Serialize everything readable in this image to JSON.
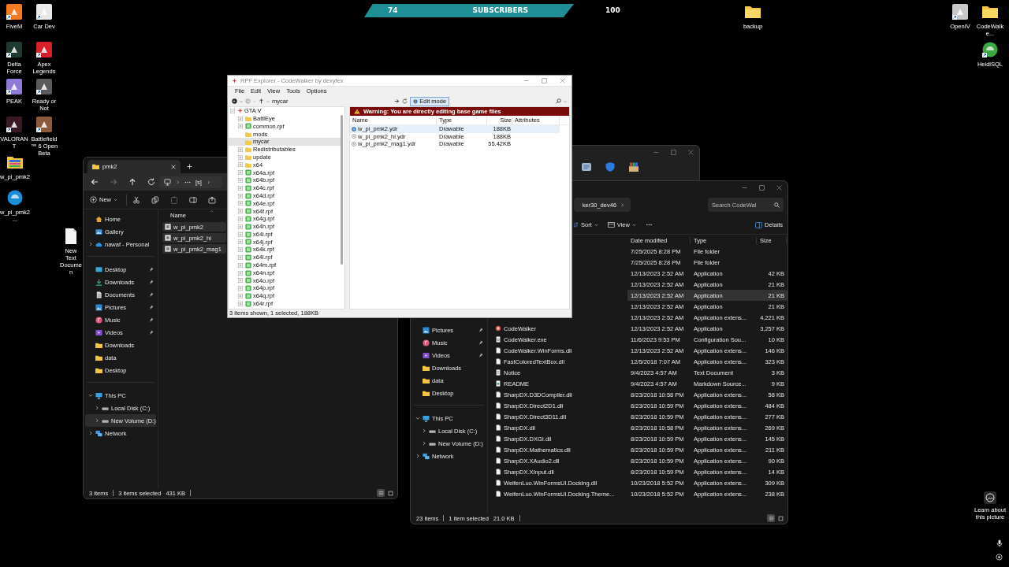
{
  "subscriber_goal": {
    "count": "74",
    "label": "SUBSCRIBERS",
    "goal": "100"
  },
  "desktop_icons": [
    {
      "label": "FiveM",
      "kind": "tile",
      "color": "#f47b20",
      "shortcut": true
    },
    {
      "label": "Car Dev",
      "kind": "tile",
      "color": "#e8e8e8",
      "shortcut": true
    },
    {
      "label": "Delta Force",
      "kind": "tile",
      "color": "#1f3b2f",
      "shortcut": true
    },
    {
      "label": "Apex Legends",
      "kind": "tile",
      "color": "#d5202a",
      "shortcut": true
    },
    {
      "label": "PEAK",
      "kind": "tile",
      "color": "#8f7ad8",
      "shortcut": true
    },
    {
      "label": "Ready or Not",
      "kind": "tile",
      "color": "#5a5a5a",
      "shortcut": true
    },
    {
      "label": "VALORANT",
      "kind": "tile",
      "color": "#3a1a24",
      "shortcut": true
    },
    {
      "label": "Battlefield™ 6 Open Beta",
      "kind": "tile",
      "color": "#8a5a3a",
      "shortcut": true
    },
    {
      "label": "w_pi_pmk2",
      "kind": "archive",
      "shortcut": false
    },
    {
      "label": "w_pi_pmk2...",
      "kind": "round",
      "color": "#1a8fd8",
      "shortcut": false
    },
    {
      "label": "New Text Documen",
      "kind": "document",
      "shortcut": false
    },
    {
      "label": "backup",
      "kind": "folder",
      "shortcut": false
    },
    {
      "label": "OpenIV",
      "kind": "tile",
      "color": "#c8c8c8",
      "shortcut": true
    },
    {
      "label": "CodeWalke...",
      "kind": "folder",
      "shortcut": false
    },
    {
      "label": "HeidiSQL",
      "kind": "round",
      "color": "#3aa845",
      "shortcut": true
    }
  ],
  "explorer_left": {
    "tab": {
      "title": "pmk2"
    },
    "breadcrumb": [
      "[s]"
    ],
    "new_label": "New",
    "sidebar": [
      {
        "items": [
          {
            "label": "Home",
            "kind": "home",
            "pinned": false,
            "selected": false
          },
          {
            "label": "Gallery",
            "kind": "gallery",
            "pinned": false,
            "selected": false
          },
          {
            "label": "nawaf - Personal",
            "kind": "cloud",
            "expanded": false,
            "pinned": false,
            "selected": false
          }
        ]
      },
      {
        "items": [
          {
            "label": "Desktop",
            "kind": "desktop",
            "pinned": true,
            "selected": false
          },
          {
            "label": "Downloads",
            "kind": "download",
            "pinned": true,
            "selected": false
          },
          {
            "label": "Documents",
            "kind": "document",
            "pinned": true,
            "selected": false
          },
          {
            "label": "Pictures",
            "kind": "pictures",
            "pinned": true,
            "selected": false
          },
          {
            "label": "Music",
            "kind": "music",
            "pinned": true,
            "selected": false
          },
          {
            "label": "Videos",
            "kind": "video",
            "pinned": true,
            "selected": false
          },
          {
            "label": "Downloads",
            "kind": "folder",
            "pinned": false,
            "selected": false
          },
          {
            "label": "data",
            "kind": "folder",
            "pinned": false,
            "selected": false
          },
          {
            "label": "Desktop",
            "kind": "folder",
            "pinned": false,
            "selected": false
          }
        ]
      },
      {
        "items": [
          {
            "label": "This PC",
            "kind": "pc",
            "expanded": true,
            "pinned": false,
            "selected": false,
            "children": [
              {
                "label": "Local Disk (C:)",
                "kind": "drive",
                "expanded": false,
                "pinned": false,
                "selected": false
              },
              {
                "label": "New Volume (D:)",
                "kind": "drive",
                "expanded": false,
                "pinned": false,
                "selected": true
              }
            ]
          },
          {
            "label": "Network",
            "kind": "network",
            "expanded": false,
            "pinned": false,
            "selected": false
          }
        ]
      }
    ],
    "columns": [
      "Name"
    ],
    "files": [
      {
        "name": "w_pi_pmk2",
        "selected": true
      },
      {
        "name": "w_pi_pmk2_hi",
        "selected": true
      },
      {
        "name": "w_pi_pmk2_mag1",
        "selected": true
      }
    ],
    "status": [
      "3 items",
      "3 items selected",
      "431 KB"
    ],
    "view_modes": [
      {
        "kind": "details",
        "selected": true
      },
      {
        "kind": "tiles",
        "selected": false
      }
    ]
  },
  "background_window": {
    "apps": [
      {
        "kind": "notes"
      },
      {
        "kind": "shield"
      },
      {
        "kind": "package"
      }
    ]
  },
  "explorer_right": {
    "address": "ker30_dev46",
    "search": {
      "placeholder": "Search CodeWal"
    },
    "sort_label": "Sort",
    "view_label": "View",
    "details_label": "Details",
    "sidebar": [
      {
        "items": [
          {
            "label": "Pictures",
            "kind": "pictures",
            "pinned": true,
            "selected": false
          },
          {
            "label": "Music",
            "kind": "music",
            "pinned": true,
            "selected": false
          },
          {
            "label": "Videos",
            "kind": "video",
            "pinned": true,
            "selected": false
          },
          {
            "label": "Downloads",
            "kind": "folder",
            "pinned": false,
            "selected": false
          },
          {
            "label": "data",
            "kind": "folder",
            "pinned": false,
            "selected": false
          },
          {
            "label": "Desktop",
            "kind": "folder",
            "pinned": false,
            "selected": false
          }
        ]
      },
      {
        "items": [
          {
            "label": "This PC",
            "kind": "pc",
            "expanded": true,
            "pinned": false,
            "selected": false,
            "children": [
              {
                "label": "Local Disk (C:)",
                "kind": "drive",
                "expanded": false,
                "pinned": false,
                "selected": false
              },
              {
                "label": "New Volume (D:)",
                "kind": "drive",
                "expanded": false,
                "pinned": false,
                "selected": false
              }
            ]
          },
          {
            "label": "Network",
            "kind": "network",
            "expanded": false,
            "pinned": false,
            "selected": false
          }
        ]
      }
    ],
    "columns": [
      "Date modified",
      "Type",
      "Size"
    ],
    "files": [
      {
        "date": "7/25/2025 8:28 PM",
        "type": "File folder",
        "selected": false
      },
      {
        "date": "7/25/2025 8:28 PM",
        "type": "File folder",
        "selected": false
      },
      {
        "date": "12/13/2023 2:52 AM",
        "type": "Application",
        "size": "42 KB",
        "selected": false
      },
      {
        "date": "12/13/2023 2:52 AM",
        "type": "Application",
        "size": "21 KB",
        "selected": false
      },
      {
        "date": "12/13/2023 2:52 AM",
        "type": "Application",
        "size": "21 KB",
        "selected": true
      },
      {
        "date": "12/13/2023 2:52 AM",
        "type": "Application",
        "size": "21 KB",
        "selected": false
      },
      {
        "date": "12/13/2023 2:52 AM",
        "type": "Application extens...",
        "size": "4,221 KB",
        "selected": false
      },
      {
        "name": "CodeWalker",
        "kind": "app",
        "date": "12/13/2023 2:52 AM",
        "type": "Application",
        "size": "3,257 KB",
        "selected": false
      },
      {
        "name": "CodeWalker.exe",
        "kind": "config",
        "date": "11/6/2023 9:53 PM",
        "type": "Configuration Sou...",
        "size": "10 KB",
        "selected": false
      },
      {
        "name": "CodeWalker.WinForms.dll",
        "kind": "file",
        "date": "12/13/2023 2:52 AM",
        "type": "Application extens...",
        "size": "146 KB",
        "selected": false
      },
      {
        "name": "FastColoredTextBox.dll",
        "kind": "file",
        "date": "12/5/2018 7:07 AM",
        "type": "Application extens...",
        "size": "323 KB",
        "selected": false
      },
      {
        "name": "Notice",
        "kind": "text",
        "date": "9/4/2023 4:57 AM",
        "type": "Text Document",
        "size": "3 KB",
        "selected": false
      },
      {
        "name": "README",
        "kind": "markdown",
        "date": "9/4/2023 4:57 AM",
        "type": "Markdown Source...",
        "size": "9 KB",
        "selected": false
      },
      {
        "name": "SharpDX.D3DCompiler.dll",
        "kind": "file",
        "date": "8/23/2018 10:58 PM",
        "type": "Application extens...",
        "size": "58 KB",
        "selected": false
      },
      {
        "name": "SharpDX.Direct2D1.dll",
        "kind": "file",
        "date": "8/23/2018 10:59 PM",
        "type": "Application extens...",
        "size": "484 KB",
        "selected": false
      },
      {
        "name": "SharpDX.Direct3D11.dll",
        "kind": "file",
        "date": "8/23/2018 10:59 PM",
        "type": "Application extens...",
        "size": "277 KB",
        "selected": false
      },
      {
        "name": "SharpDX.dll",
        "kind": "file",
        "date": "8/23/2018 10:58 PM",
        "type": "Application extens...",
        "size": "269 KB",
        "selected": false
      },
      {
        "name": "SharpDX.DXGI.dll",
        "kind": "file",
        "date": "8/23/2018 10:59 PM",
        "type": "Application extens...",
        "size": "145 KB",
        "selected": false
      },
      {
        "name": "SharpDX.Mathematics.dll",
        "kind": "file",
        "date": "8/23/2018 10:59 PM",
        "type": "Application extens...",
        "size": "211 KB",
        "selected": false
      },
      {
        "name": "SharpDX.XAudio2.dll",
        "kind": "file",
        "date": "8/23/2018 10:59 PM",
        "type": "Application extens...",
        "size": "90 KB",
        "selected": false
      },
      {
        "name": "SharpDX.XInput.dll",
        "kind": "file",
        "date": "8/23/2018 10:59 PM",
        "type": "Application extens...",
        "size": "14 KB",
        "selected": false
      },
      {
        "name": "WeifenLuo.WinFormsUI.Docking.dll",
        "kind": "file",
        "date": "10/23/2018 5:52 PM",
        "type": "Application extens...",
        "size": "309 KB",
        "selected": false
      },
      {
        "name": "WeifenLuo.WinFormsUI.Docking.Theme...",
        "kind": "file",
        "date": "10/23/2018 5:52 PM",
        "type": "Application extens...",
        "size": "238 KB",
        "selected": false
      }
    ],
    "status": [
      "23 items",
      "1 item selected",
      "21.0 KB"
    ],
    "view_modes": [
      {
        "kind": "details",
        "selected": true
      },
      {
        "kind": "tiles",
        "selected": false
      }
    ]
  },
  "rpf_explorer": {
    "title": "RPF Explorer - CodeWalker by dexyfex",
    "menu": [
      "File",
      "Edit",
      "View",
      "Tools",
      "Options"
    ],
    "path": "mycar",
    "edit_mode": {
      "label": "Edit mode",
      "on": true
    },
    "tree": [
      {
        "label": "GTA V",
        "kind": "root",
        "expanded": true,
        "selected": false,
        "children": [
          {
            "label": "BattlEye",
            "kind": "folder",
            "expanded": false,
            "selected": false
          },
          {
            "label": "common.rpf",
            "kind": "archive",
            "expanded": false,
            "selected": false
          },
          {
            "label": "mods",
            "kind": "folder",
            "selected": false
          },
          {
            "label": "mycar",
            "kind": "folder",
            "selected": true
          },
          {
            "label": "Redistributables",
            "kind": "folder",
            "expanded": false,
            "selected": false
          },
          {
            "label": "update",
            "kind": "folder",
            "expanded": false,
            "selected": false
          },
          {
            "label": "x64",
            "kind": "folder",
            "expanded": false,
            "selected": false
          },
          {
            "label": "x64a.rpf",
            "kind": "archive",
            "expanded": false,
            "selected": false
          },
          {
            "label": "x64b.rpf",
            "kind": "archive",
            "expanded": false,
            "selected": false
          },
          {
            "label": "x64c.rpf",
            "kind": "archive",
            "expanded": false,
            "selected": false
          },
          {
            "label": "x64d.rpf",
            "kind": "archive",
            "expanded": false,
            "selected": false
          },
          {
            "label": "x64e.rpf",
            "kind": "archive",
            "expanded": false,
            "selected": false
          },
          {
            "label": "x64f.rpf",
            "kind": "archive",
            "expanded": false,
            "selected": false
          },
          {
            "label": "x64g.rpf",
            "kind": "archive",
            "expanded": false,
            "selected": false
          },
          {
            "label": "x64h.rpf",
            "kind": "archive",
            "expanded": false,
            "selected": false
          },
          {
            "label": "x64i.rpf",
            "kind": "archive",
            "expanded": false,
            "selected": false
          },
          {
            "label": "x64j.rpf",
            "kind": "archive",
            "expanded": false,
            "selected": false
          },
          {
            "label": "x64k.rpf",
            "kind": "archive",
            "expanded": false,
            "selected": false
          },
          {
            "label": "x64l.rpf",
            "kind": "archive",
            "expanded": false,
            "selected": false
          },
          {
            "label": "x64m.rpf",
            "kind": "archive",
            "expanded": false,
            "selected": false
          },
          {
            "label": "x64n.rpf",
            "kind": "archive",
            "expanded": false,
            "selected": false
          },
          {
            "label": "x64o.rpf",
            "kind": "archive",
            "expanded": false,
            "selected": false
          },
          {
            "label": "x64p.rpf",
            "kind": "archive",
            "expanded": false,
            "selected": false
          },
          {
            "label": "x64q.rpf",
            "kind": "archive",
            "expanded": false,
            "selected": false
          },
          {
            "label": "x64r.rpf",
            "kind": "archive",
            "expanded": false,
            "selected": false
          }
        ]
      }
    ],
    "warning": "Warning: You are directly editing base game files",
    "columns": [
      "Name",
      "Type",
      "Size",
      "Attributes"
    ],
    "files": [
      {
        "name": "w_pi_pmk2.ydr",
        "type": "Drawable",
        "size": "188KB",
        "selected": true
      },
      {
        "name": "w_pi_pmk2_hi.ydr",
        "type": "Drawable",
        "size": "188KB",
        "selected": false
      },
      {
        "name": "w_pi_pmk2_mag1.ydr",
        "type": "Drawable",
        "size": "55.42KB",
        "selected": false
      }
    ],
    "status": "3 items shown, 1 selected, 188KB"
  },
  "picture_info": {
    "label": "Learn about this picture"
  }
}
